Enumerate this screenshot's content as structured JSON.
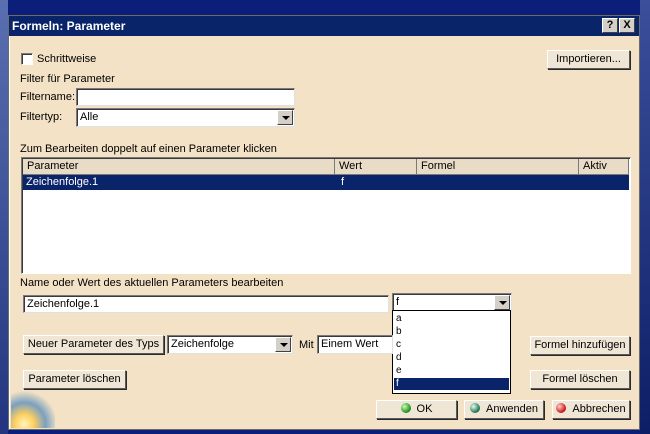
{
  "window": {
    "title": "Formeln: Parameter",
    "help_label": "?",
    "close_label": "X"
  },
  "top": {
    "step_checkbox_label": "Schrittweise",
    "import_button": "Importieren...",
    "filter_heading": "Filter für Parameter",
    "filtername_label": "Filtername:",
    "filtername_value": "",
    "filtertype_label": "Filtertyp:",
    "filtertype_value": "Alle"
  },
  "table": {
    "instruction": "Zum Bearbeiten doppelt auf einen Parameter klicken",
    "columns": [
      "Parameter",
      "Wert",
      "Formel",
      "Aktiv"
    ],
    "rows": [
      {
        "parameter": "Zeichenfolge.1",
        "wert": "f",
        "formel": "",
        "aktiv": ""
      }
    ]
  },
  "edit": {
    "label": "Name oder Wert des aktuellen Parameters bearbeiten",
    "name_value": "Zeichenfolge.1",
    "value_select": "f",
    "options": [
      "a",
      "b",
      "c",
      "d",
      "e",
      "f"
    ],
    "selected_option": "f"
  },
  "new_param": {
    "button": "Neuer Parameter des Typs",
    "type_value": "Zeichenfolge",
    "mit_label": "Mit",
    "mit_value": "Einem Wert"
  },
  "buttons": {
    "add_formula": "Formel hinzufügen",
    "delete_param": "Parameter löschen",
    "delete_formula": "Formel löschen",
    "ok": "OK",
    "apply": "Anwenden",
    "cancel": "Abbrechen"
  }
}
